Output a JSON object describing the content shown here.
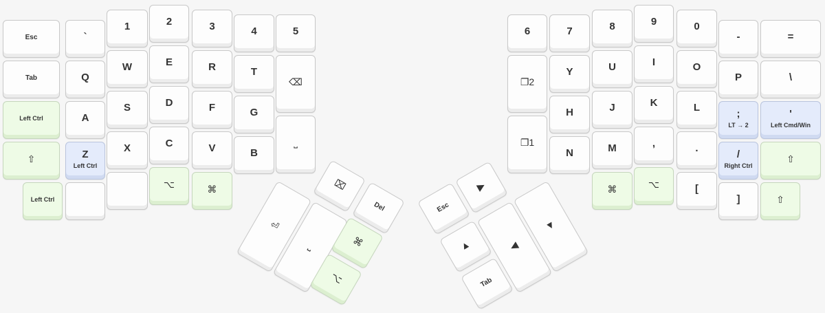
{
  "colors": {
    "plain": "#fdfdfd",
    "green": "#eefbe6",
    "blue": "#e4ebfb",
    "text": "#333333"
  },
  "keys": [
    {
      "id": "esc",
      "label": "Esc",
      "size": "small"
    },
    {
      "id": "grave",
      "label": "`"
    },
    {
      "id": "n1",
      "label": "1"
    },
    {
      "id": "n2",
      "label": "2"
    },
    {
      "id": "n3",
      "label": "3"
    },
    {
      "id": "n4",
      "label": "4"
    },
    {
      "id": "n5",
      "label": "5"
    },
    {
      "id": "tab",
      "label": "Tab",
      "size": "small"
    },
    {
      "id": "q",
      "label": "Q"
    },
    {
      "id": "w",
      "label": "W"
    },
    {
      "id": "e",
      "label": "E"
    },
    {
      "id": "r",
      "label": "R"
    },
    {
      "id": "t",
      "label": "T"
    },
    {
      "id": "bksp-top",
      "label": "⌫",
      "icon": "backspace-icon"
    },
    {
      "id": "lctrl-home",
      "label": "Left Ctrl",
      "size": "tiny",
      "color": "green"
    },
    {
      "id": "a",
      "label": "A"
    },
    {
      "id": "s",
      "label": "S"
    },
    {
      "id": "d",
      "label": "D"
    },
    {
      "id": "f",
      "label": "F"
    },
    {
      "id": "g",
      "label": "G"
    },
    {
      "id": "space-top",
      "label": "⎵",
      "icon": "space-icon"
    },
    {
      "id": "lshift",
      "label": "⇧",
      "icon": "shift-icon",
      "color": "green"
    },
    {
      "id": "z",
      "label": "Z",
      "sub": "Left Ctrl",
      "color": "blue"
    },
    {
      "id": "x",
      "label": "X"
    },
    {
      "id": "c",
      "label": "C"
    },
    {
      "id": "v",
      "label": "V"
    },
    {
      "id": "b",
      "label": "B"
    },
    {
      "id": "lctrl-bottom",
      "label": "Left Ctrl",
      "size": "tiny",
      "color": "green"
    },
    {
      "id": "blank-l1",
      "label": ""
    },
    {
      "id": "blank-l2",
      "label": ""
    },
    {
      "id": "lalt",
      "label": "⌥",
      "icon": "option-icon",
      "color": "green"
    },
    {
      "id": "lcmd",
      "label": "⌘",
      "icon": "command-icon",
      "color": "green"
    },
    {
      "id": "n6",
      "label": "6"
    },
    {
      "id": "n7",
      "label": "7"
    },
    {
      "id": "n8",
      "label": "8"
    },
    {
      "id": "n9",
      "label": "9"
    },
    {
      "id": "n0",
      "label": "0"
    },
    {
      "id": "minus",
      "label": "-"
    },
    {
      "id": "equal",
      "label": "="
    },
    {
      "id": "layer2",
      "label": "❐2",
      "size": "small",
      "icon": "layer-icon"
    },
    {
      "id": "y",
      "label": "Y"
    },
    {
      "id": "u",
      "label": "U"
    },
    {
      "id": "i",
      "label": "I"
    },
    {
      "id": "o",
      "label": "O"
    },
    {
      "id": "p",
      "label": "P"
    },
    {
      "id": "bslash",
      "label": "\\"
    },
    {
      "id": "h",
      "label": "H"
    },
    {
      "id": "j",
      "label": "J"
    },
    {
      "id": "k",
      "label": "K"
    },
    {
      "id": "l",
      "label": "L"
    },
    {
      "id": "semi",
      "label": ";",
      "sub": "LT → 2",
      "color": "blue"
    },
    {
      "id": "quote",
      "label": "'",
      "sub": "Left Cmd/Win",
      "color": "blue"
    },
    {
      "id": "layer1",
      "label": "❐1",
      "size": "small",
      "icon": "layer-icon"
    },
    {
      "id": "n",
      "label": "N"
    },
    {
      "id": "m",
      "label": "M"
    },
    {
      "id": "comma",
      "label": ","
    },
    {
      "id": "period",
      "label": "."
    },
    {
      "id": "slash",
      "label": "/",
      "sub": "Right Ctrl",
      "color": "blue"
    },
    {
      "id": "rshift",
      "label": "⇧",
      "icon": "shift-icon",
      "color": "green"
    },
    {
      "id": "rcmd",
      "label": "⌘",
      "icon": "command-icon",
      "color": "green"
    },
    {
      "id": "ralt",
      "label": "⌥",
      "icon": "option-icon",
      "color": "green"
    },
    {
      "id": "lbracket",
      "label": "["
    },
    {
      "id": "rbracket",
      "label": "]"
    },
    {
      "id": "rshift2",
      "label": "⇧",
      "icon": "shift-icon",
      "color": "green"
    },
    {
      "id": "thumb-enter",
      "label": "⏎",
      "icon": "enter-icon"
    },
    {
      "id": "thumb-space",
      "label": "⎵",
      "icon": "space-icon"
    },
    {
      "id": "thumb-clear",
      "label": "⌧",
      "icon": "clear-icon"
    },
    {
      "id": "thumb-del",
      "label": "Del",
      "size": "small"
    },
    {
      "id": "thumb-cmd",
      "label": "⌘",
      "icon": "command-icon",
      "color": "green"
    },
    {
      "id": "thumb-alt",
      "label": "⌥",
      "icon": "option-icon",
      "color": "green"
    },
    {
      "id": "thumb-esc",
      "label": "Esc",
      "size": "small"
    },
    {
      "id": "thumb-right",
      "label": "▶",
      "icon": "play-icon"
    },
    {
      "id": "thumb-up",
      "label": "▲",
      "icon": "up-triangle-icon"
    },
    {
      "id": "thumb-left",
      "label": "◀",
      "icon": "left-triangle-icon"
    },
    {
      "id": "thumb-down",
      "label": "▼",
      "icon": "down-triangle-icon"
    },
    {
      "id": "thumb-tab",
      "label": "Tab",
      "size": "small"
    }
  ]
}
